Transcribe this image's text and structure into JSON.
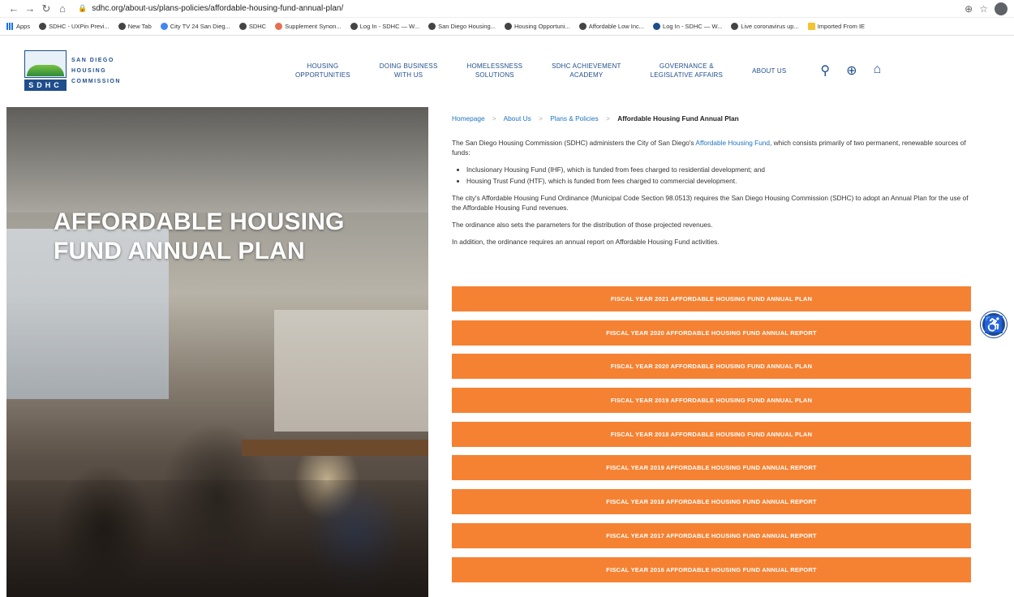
{
  "browser": {
    "url": "sdhc.org/about-us/plans-policies/affordable-housing-fund-annual-plan/",
    "bookmarks": [
      {
        "label": "Apps",
        "color": "#1a73e8",
        "kind": "grid"
      },
      {
        "label": "SDHC - UXPin Previ...",
        "color": "#444444"
      },
      {
        "label": "New Tab",
        "color": "#444444"
      },
      {
        "label": "City TV 24 San Dieg...",
        "color": "#4285f4"
      },
      {
        "label": "SDHC",
        "color": "#444444"
      },
      {
        "label": "Supplement Synon...",
        "color": "#e76f51"
      },
      {
        "label": "Log In - SDHC — W...",
        "color": "#444444"
      },
      {
        "label": "San Diego Housing...",
        "color": "#444444"
      },
      {
        "label": "Housing Opportuni...",
        "color": "#444444"
      },
      {
        "label": "Affordable Low Inc...",
        "color": "#444444"
      },
      {
        "label": "Log In - SDHC — W...",
        "color": "#1f4e8c"
      },
      {
        "label": "Live coronavirus up...",
        "color": "#444444"
      },
      {
        "label": "Imported From IE",
        "color": "#f4c430",
        "kind": "folder"
      }
    ]
  },
  "logo": {
    "line1": "SAN DIEGO",
    "line2": "HOUSING",
    "line3": "COMMISSION",
    "mark": "SDHC"
  },
  "nav": {
    "items": [
      {
        "line1": "HOUSING",
        "line2": "OPPORTUNITIES"
      },
      {
        "line1": "DOING BUSINESS",
        "line2": "WITH US"
      },
      {
        "line1": "HOMELESSNESS",
        "line2": "SOLUTIONS"
      },
      {
        "line1": "SDHC ACHIEVEMENT",
        "line2": "ACADEMY"
      },
      {
        "line1": "GOVERNANCE &",
        "line2": "LEGISLATIVE AFFAIRS"
      },
      {
        "line1": "ABOUT US",
        "line2": ""
      }
    ]
  },
  "hero": {
    "title": "AFFORDABLE HOUSING FUND ANNUAL PLAN"
  },
  "breadcrumb": {
    "home": "Homepage",
    "about": "About Us",
    "plans": "Plans & Policies",
    "current": "Affordable Housing Fund Annual Plan"
  },
  "body": {
    "intro_before": "The San Diego Housing Commission (SDHC) administers the City of San Diego's ",
    "intro_link": "Affordable Housing Fund",
    "intro_after": ", which consists primarily of two permanent, renewable sources of funds:",
    "bullets": [
      "Inclusionary Housing Fund (IHF), which is funded from fees charged to residential development; and",
      "Housing Trust Fund (HTF), which is funded from fees charged to commercial development."
    ],
    "para2": "The city's Affordable Housing Fund Ordinance (Municipal Code Section 98.0513) requires the San Diego Housing Commission (SDHC) to adopt an Annual Plan for the use of the Affordable Housing Fund revenues.",
    "para3": "The ordinance also sets the parameters for the distribution of those projected revenues.",
    "para4": "In addition, the ordinance requires an annual report on Affordable Housing Fund activities."
  },
  "buttons": [
    "FISCAL YEAR 2021 AFFORDABLE HOUSING FUND ANNUAL PLAN",
    "FISCAL YEAR 2020 AFFORDABLE HOUSING FUND ANNUAL REPORT",
    "FISCAL YEAR 2020 AFFORDABLE HOUSING FUND ANNUAL PLAN",
    "FISCAL YEAR 2019 AFFORDABLE HOUSING FUND ANNUAL PLAN",
    "FISCAL YEAR 2018 AFFORDABLE HOUSING FUND ANNUAL PLAN",
    "FISCAL YEAR 2019 AFFORDABLE HOUSING FUND ANNUAL REPORT",
    "FISCAL YEAR 2018 AFFORDABLE HOUSING FUND ANNUAL REPORT",
    "FISCAL YEAR 2017 AFFORDABLE HOUSING FUND ANNUAL REPORT",
    "FISCAL YEAR 2016 AFFORDABLE HOUSING FUND ANNUAL REPORT"
  ],
  "colors": {
    "accent_orange": "#f58233",
    "brand_blue": "#1f4e8c",
    "link_blue": "#1e73be"
  },
  "icons": {
    "back": "back-arrow-icon",
    "forward": "forward-arrow-icon",
    "reload": "reload-icon",
    "home": "home-icon",
    "search": "search-icon",
    "globe": "globe-icon",
    "site_home": "house-icon",
    "accessibility": "accessibility-icon"
  }
}
